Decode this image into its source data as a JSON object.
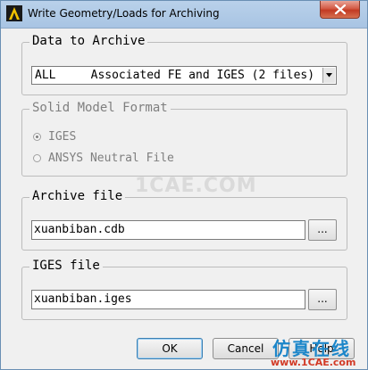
{
  "window": {
    "title": "Write Geometry/Loads for Archiving"
  },
  "data_to_archive": {
    "label": "Data to Archive",
    "selected_value": "ALL     Associated FE and IGES (2 files)"
  },
  "solid_model_format": {
    "label": "Solid Model Format",
    "options": [
      {
        "label": "IGES",
        "checked": true
      },
      {
        "label": "ANSYS Neutral File",
        "checked": false
      }
    ]
  },
  "archive_file": {
    "label": "Archive file",
    "value": "xuanbiban.cdb",
    "browse_label": "..."
  },
  "iges_file": {
    "label": "IGES file",
    "value": "xuanbiban.iges",
    "browse_label": "..."
  },
  "footer": {
    "ok_label": "OK",
    "cancel_label": "Cancel",
    "help_label": "Help"
  },
  "watermark": {
    "text": "1CAE.COM",
    "brand_cn": "仿真在线",
    "brand_url": "www.1CAE.com"
  },
  "colors": {
    "titlebar": "#b9d1ea",
    "close_button": "#c23a22",
    "brand_blue": "#1c86c9",
    "brand_red": "#d23a26"
  }
}
